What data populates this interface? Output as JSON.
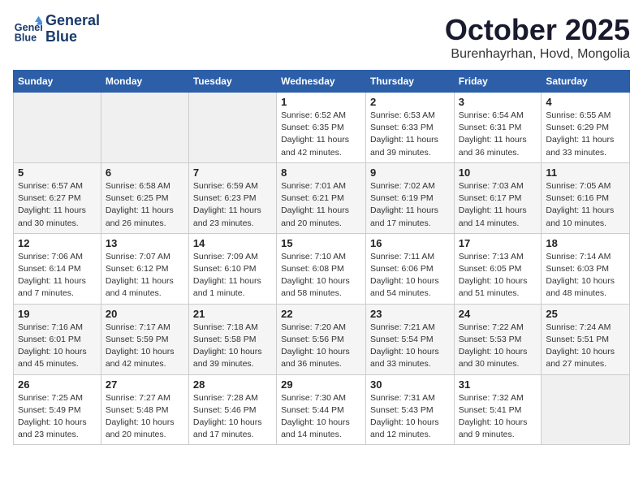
{
  "header": {
    "logo_line1": "General",
    "logo_line2": "Blue",
    "month": "October 2025",
    "location": "Burenhayrhan, Hovd, Mongolia"
  },
  "weekdays": [
    "Sunday",
    "Monday",
    "Tuesday",
    "Wednesday",
    "Thursday",
    "Friday",
    "Saturday"
  ],
  "weeks": [
    [
      {
        "day": "",
        "sunrise": "",
        "sunset": "",
        "daylight": ""
      },
      {
        "day": "",
        "sunrise": "",
        "sunset": "",
        "daylight": ""
      },
      {
        "day": "",
        "sunrise": "",
        "sunset": "",
        "daylight": ""
      },
      {
        "day": "1",
        "sunrise": "Sunrise: 6:52 AM",
        "sunset": "Sunset: 6:35 PM",
        "daylight": "Daylight: 11 hours and 42 minutes."
      },
      {
        "day": "2",
        "sunrise": "Sunrise: 6:53 AM",
        "sunset": "Sunset: 6:33 PM",
        "daylight": "Daylight: 11 hours and 39 minutes."
      },
      {
        "day": "3",
        "sunrise": "Sunrise: 6:54 AM",
        "sunset": "Sunset: 6:31 PM",
        "daylight": "Daylight: 11 hours and 36 minutes."
      },
      {
        "day": "4",
        "sunrise": "Sunrise: 6:55 AM",
        "sunset": "Sunset: 6:29 PM",
        "daylight": "Daylight: 11 hours and 33 minutes."
      }
    ],
    [
      {
        "day": "5",
        "sunrise": "Sunrise: 6:57 AM",
        "sunset": "Sunset: 6:27 PM",
        "daylight": "Daylight: 11 hours and 30 minutes."
      },
      {
        "day": "6",
        "sunrise": "Sunrise: 6:58 AM",
        "sunset": "Sunset: 6:25 PM",
        "daylight": "Daylight: 11 hours and 26 minutes."
      },
      {
        "day": "7",
        "sunrise": "Sunrise: 6:59 AM",
        "sunset": "Sunset: 6:23 PM",
        "daylight": "Daylight: 11 hours and 23 minutes."
      },
      {
        "day": "8",
        "sunrise": "Sunrise: 7:01 AM",
        "sunset": "Sunset: 6:21 PM",
        "daylight": "Daylight: 11 hours and 20 minutes."
      },
      {
        "day": "9",
        "sunrise": "Sunrise: 7:02 AM",
        "sunset": "Sunset: 6:19 PM",
        "daylight": "Daylight: 11 hours and 17 minutes."
      },
      {
        "day": "10",
        "sunrise": "Sunrise: 7:03 AM",
        "sunset": "Sunset: 6:17 PM",
        "daylight": "Daylight: 11 hours and 14 minutes."
      },
      {
        "day": "11",
        "sunrise": "Sunrise: 7:05 AM",
        "sunset": "Sunset: 6:16 PM",
        "daylight": "Daylight: 11 hours and 10 minutes."
      }
    ],
    [
      {
        "day": "12",
        "sunrise": "Sunrise: 7:06 AM",
        "sunset": "Sunset: 6:14 PM",
        "daylight": "Daylight: 11 hours and 7 minutes."
      },
      {
        "day": "13",
        "sunrise": "Sunrise: 7:07 AM",
        "sunset": "Sunset: 6:12 PM",
        "daylight": "Daylight: 11 hours and 4 minutes."
      },
      {
        "day": "14",
        "sunrise": "Sunrise: 7:09 AM",
        "sunset": "Sunset: 6:10 PM",
        "daylight": "Daylight: 11 hours and 1 minute."
      },
      {
        "day": "15",
        "sunrise": "Sunrise: 7:10 AM",
        "sunset": "Sunset: 6:08 PM",
        "daylight": "Daylight: 10 hours and 58 minutes."
      },
      {
        "day": "16",
        "sunrise": "Sunrise: 7:11 AM",
        "sunset": "Sunset: 6:06 PM",
        "daylight": "Daylight: 10 hours and 54 minutes."
      },
      {
        "day": "17",
        "sunrise": "Sunrise: 7:13 AM",
        "sunset": "Sunset: 6:05 PM",
        "daylight": "Daylight: 10 hours and 51 minutes."
      },
      {
        "day": "18",
        "sunrise": "Sunrise: 7:14 AM",
        "sunset": "Sunset: 6:03 PM",
        "daylight": "Daylight: 10 hours and 48 minutes."
      }
    ],
    [
      {
        "day": "19",
        "sunrise": "Sunrise: 7:16 AM",
        "sunset": "Sunset: 6:01 PM",
        "daylight": "Daylight: 10 hours and 45 minutes."
      },
      {
        "day": "20",
        "sunrise": "Sunrise: 7:17 AM",
        "sunset": "Sunset: 5:59 PM",
        "daylight": "Daylight: 10 hours and 42 minutes."
      },
      {
        "day": "21",
        "sunrise": "Sunrise: 7:18 AM",
        "sunset": "Sunset: 5:58 PM",
        "daylight": "Daylight: 10 hours and 39 minutes."
      },
      {
        "day": "22",
        "sunrise": "Sunrise: 7:20 AM",
        "sunset": "Sunset: 5:56 PM",
        "daylight": "Daylight: 10 hours and 36 minutes."
      },
      {
        "day": "23",
        "sunrise": "Sunrise: 7:21 AM",
        "sunset": "Sunset: 5:54 PM",
        "daylight": "Daylight: 10 hours and 33 minutes."
      },
      {
        "day": "24",
        "sunrise": "Sunrise: 7:22 AM",
        "sunset": "Sunset: 5:53 PM",
        "daylight": "Daylight: 10 hours and 30 minutes."
      },
      {
        "day": "25",
        "sunrise": "Sunrise: 7:24 AM",
        "sunset": "Sunset: 5:51 PM",
        "daylight": "Daylight: 10 hours and 27 minutes."
      }
    ],
    [
      {
        "day": "26",
        "sunrise": "Sunrise: 7:25 AM",
        "sunset": "Sunset: 5:49 PM",
        "daylight": "Daylight: 10 hours and 23 minutes."
      },
      {
        "day": "27",
        "sunrise": "Sunrise: 7:27 AM",
        "sunset": "Sunset: 5:48 PM",
        "daylight": "Daylight: 10 hours and 20 minutes."
      },
      {
        "day": "28",
        "sunrise": "Sunrise: 7:28 AM",
        "sunset": "Sunset: 5:46 PM",
        "daylight": "Daylight: 10 hours and 17 minutes."
      },
      {
        "day": "29",
        "sunrise": "Sunrise: 7:30 AM",
        "sunset": "Sunset: 5:44 PM",
        "daylight": "Daylight: 10 hours and 14 minutes."
      },
      {
        "day": "30",
        "sunrise": "Sunrise: 7:31 AM",
        "sunset": "Sunset: 5:43 PM",
        "daylight": "Daylight: 10 hours and 12 minutes."
      },
      {
        "day": "31",
        "sunrise": "Sunrise: 7:32 AM",
        "sunset": "Sunset: 5:41 PM",
        "daylight": "Daylight: 10 hours and 9 minutes."
      },
      {
        "day": "",
        "sunrise": "",
        "sunset": "",
        "daylight": ""
      }
    ]
  ]
}
